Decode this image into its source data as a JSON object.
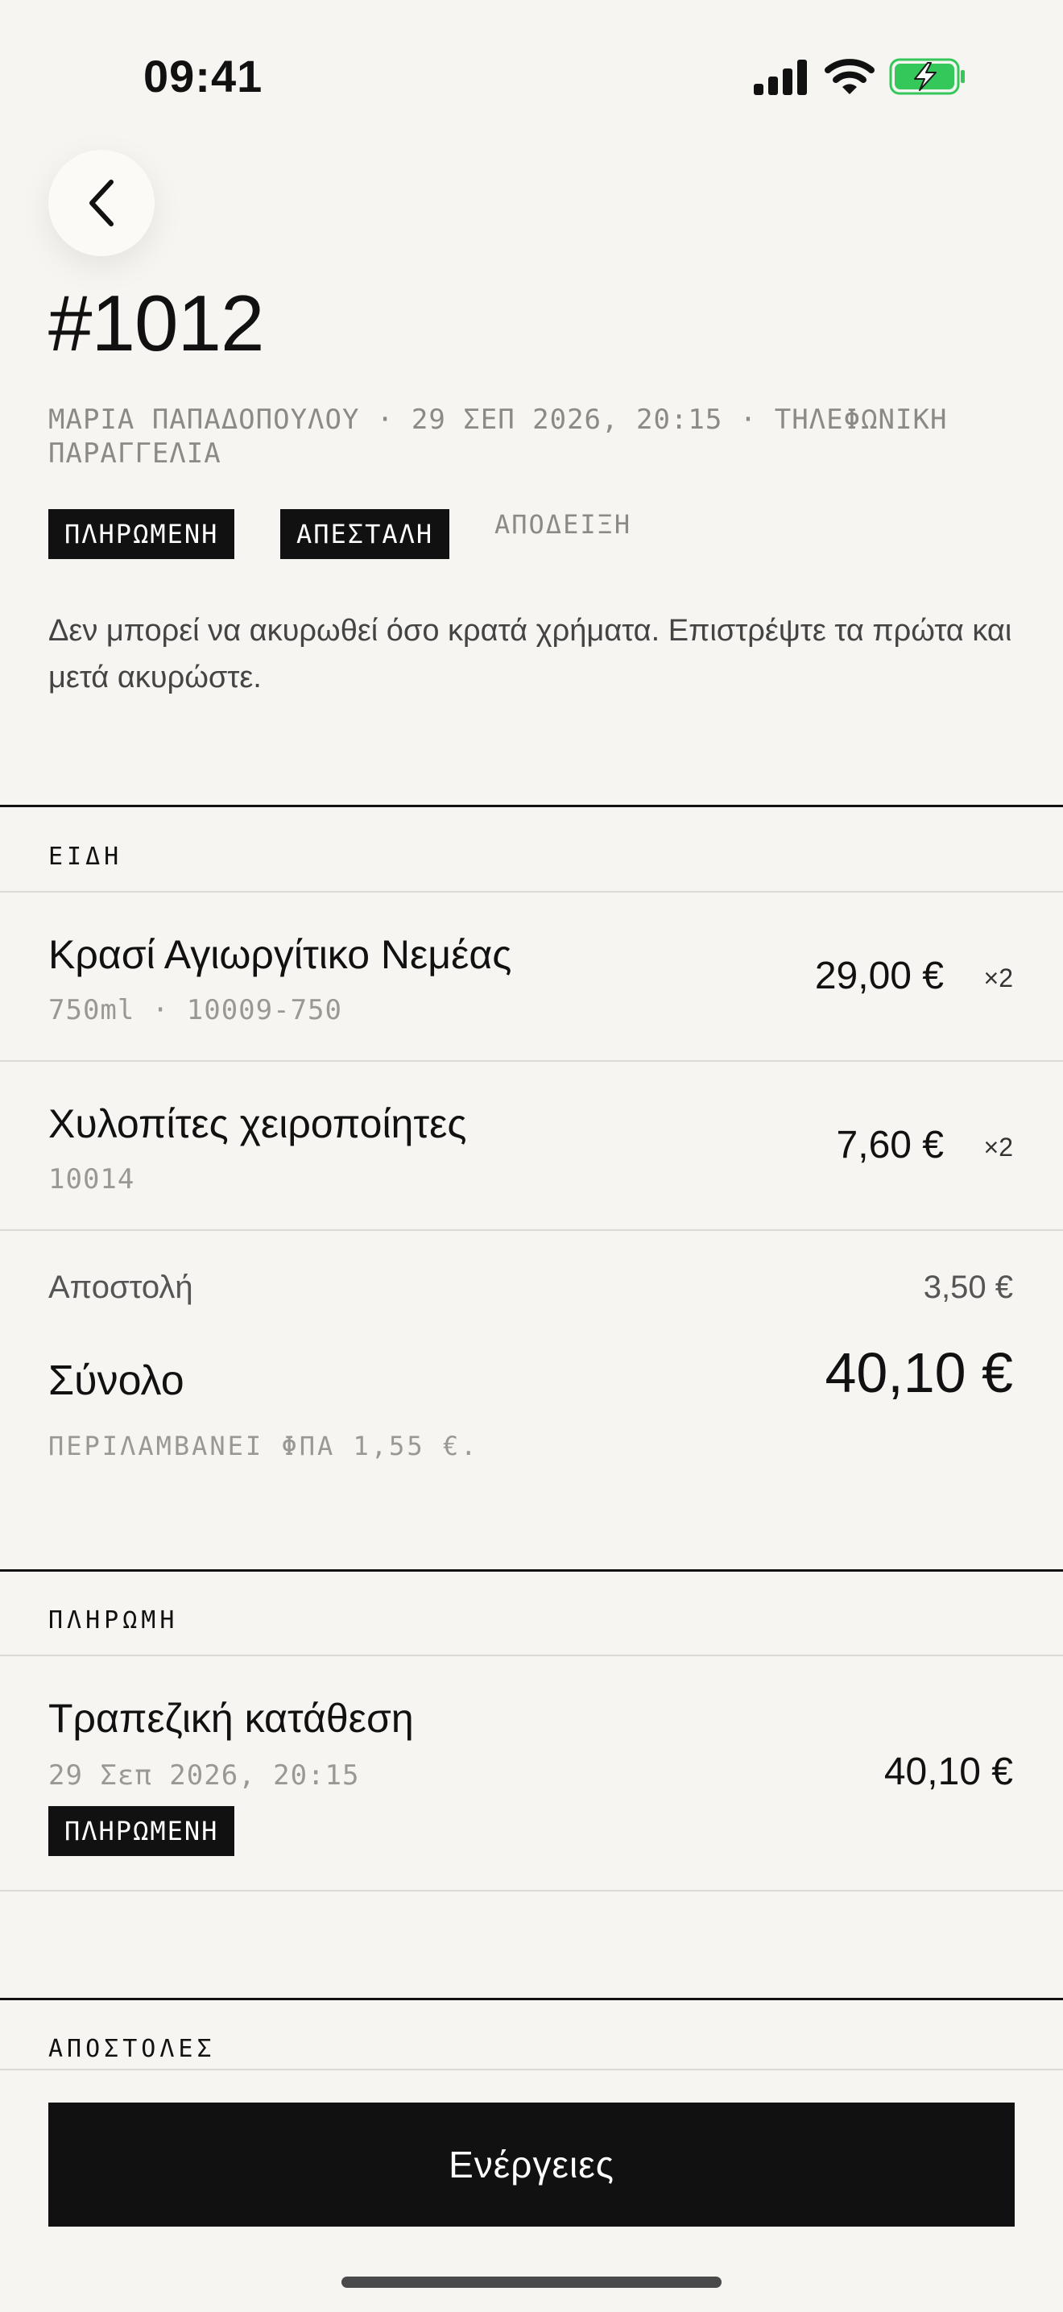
{
  "status_bar": {
    "time": "09:41"
  },
  "order": {
    "title": "#1012",
    "meta": "ΜΑΡΙΑ ΠΑΠΑΔΟΠΟΥΛΟΥ · 29 ΣΕΠ 2026, 20:15 · ΤΗΛΕΦΩΝΙΚΗ ΠΑΡΑΓΓΕΛΙΑ",
    "badges": {
      "paid": "ΠΛΗΡΩΜΕΝΗ",
      "shipped": "ΑΠΕΣΤΑΛΗ"
    },
    "receipt_link": "ΑΠΟΔΕΙΞΗ",
    "notice": "Δεν μπορεί να ακυρωθεί όσο κρατά χρήματα. Επιστρέψτε τα πρώτα και μετά ακυρώστε."
  },
  "items_section": {
    "heading": "ΕΙΔΗ",
    "items": [
      {
        "name": "Κρασί Αγιωργίτικο Νεμέας",
        "sub": "750ml · 10009-750",
        "price": "29,00 €",
        "qty": "×2"
      },
      {
        "name": "Χυλοπίτες χειροποίητες",
        "sub": "10014",
        "price": "7,60 €",
        "qty": "×2"
      }
    ],
    "shipping_label": "Αποστολή",
    "shipping_value": "3,50 €",
    "total_label": "Σύνολο",
    "total_value": "40,10 €",
    "vat_note": "ΠΕΡΙΛΑΜΒΑΝΕΙ ΦΠΑ 1,55 €."
  },
  "payment_section": {
    "heading": "ΠΛΗΡΩΜΗ",
    "method": "Τραπεζική κατάθεση",
    "date": "29 Σεπ 2026, 20:15",
    "status": "ΠΛΗΡΩΜΕΝΗ",
    "amount": "40,10 €"
  },
  "shipments_section": {
    "heading": "ΑΠΟΣΤΟΛΕΣ"
  },
  "actions_button": "Ενέργειες",
  "colors": {
    "background": "#f6f5f1",
    "ink": "#111111",
    "muted": "#9a9893",
    "battery_green": "#34c759"
  },
  "icons": [
    "cellular-signal-icon",
    "wifi-icon",
    "battery-charging-icon",
    "chevron-left-icon"
  ]
}
